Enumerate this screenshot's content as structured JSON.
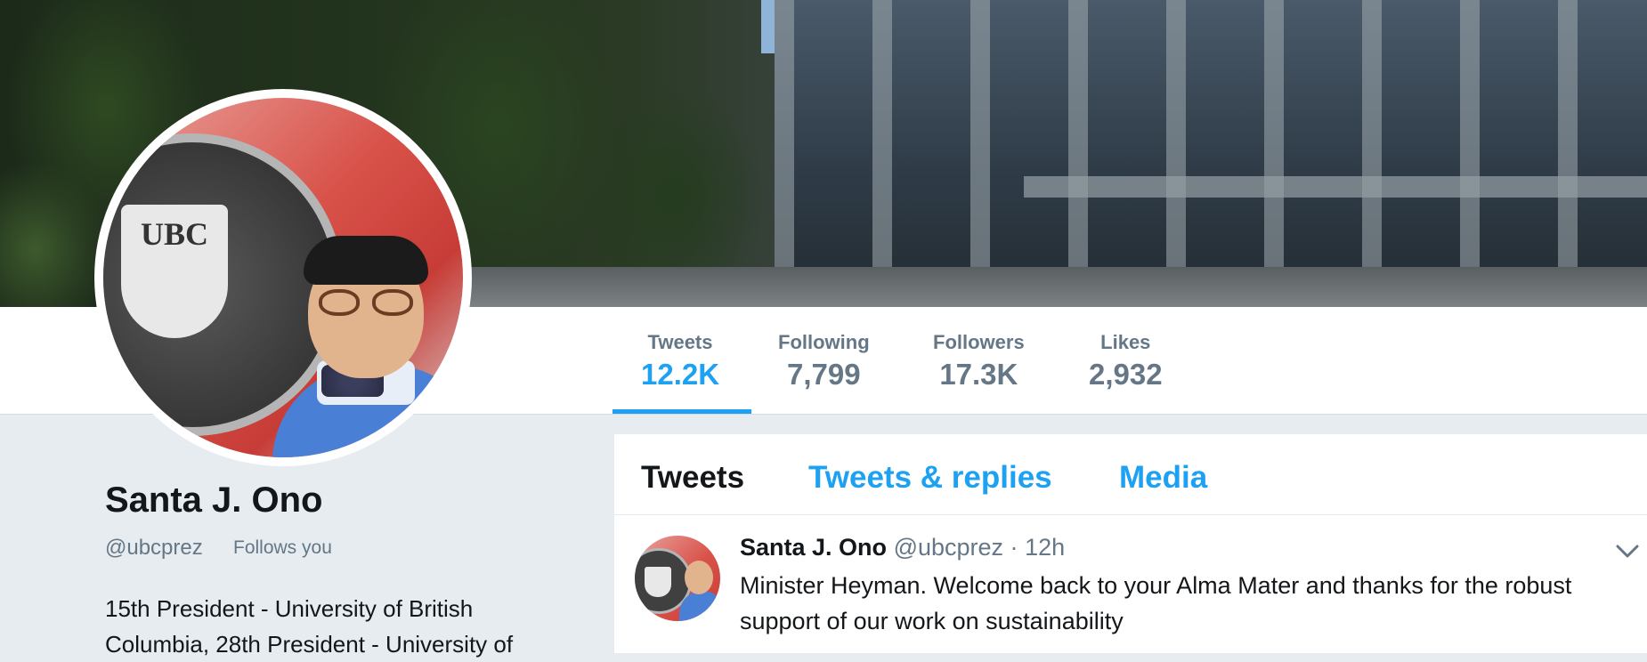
{
  "stats": [
    {
      "label": "Tweets",
      "value": "12.2K"
    },
    {
      "label": "Following",
      "value": "7,799"
    },
    {
      "label": "Followers",
      "value": "17.3K"
    },
    {
      "label": "Likes",
      "value": "2,932"
    }
  ],
  "profile": {
    "name": "Santa J. Ono",
    "handle": "@ubcprez",
    "follows_you": "Follows you",
    "bio": "15th President - University of British Columbia, 28th President - University of"
  },
  "avatar": {
    "seal_text": "UBC"
  },
  "tabs": [
    {
      "label": "Tweets"
    },
    {
      "label": "Tweets & replies"
    },
    {
      "label": "Media"
    }
  ],
  "tweet": {
    "name": "Santa J. Ono",
    "handle": "@ubcprez",
    "separator": "·",
    "time": "12h",
    "text": "Minister Heyman. Welcome back to your Alma Mater and thanks for the robust support of our work on sustainability"
  },
  "colors": {
    "accent": "#1da1f2",
    "secondary_text": "#657786",
    "primary_text": "#14171a",
    "page_background": "#e6ecf0"
  },
  "icons": {
    "tweet_menu": "chevron-down-icon"
  }
}
